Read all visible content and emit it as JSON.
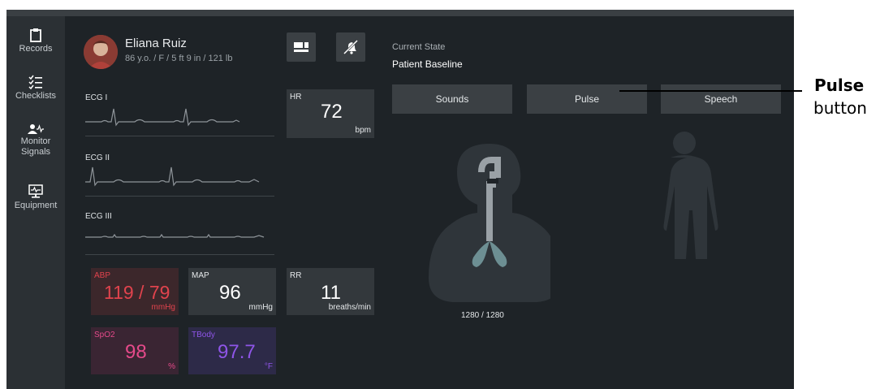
{
  "sidebar": {
    "items": [
      {
        "label": "Records",
        "icon": "clipboard-icon"
      },
      {
        "label": "Checklists",
        "icon": "checklist-icon"
      },
      {
        "label": "Monitor Signals",
        "icon": "monitor-signals-icon"
      },
      {
        "label": "Equipment",
        "icon": "equipment-icon"
      }
    ]
  },
  "patient": {
    "name": "Eliana Ruiz",
    "info": "86 y.o. / F / 5 ft 9 in / 121 lb"
  },
  "ecg": [
    {
      "label": "ECG I"
    },
    {
      "label": "ECG II"
    },
    {
      "label": "ECG III"
    }
  ],
  "vitals": {
    "hr": {
      "label": "HR",
      "value": "72",
      "unit": "bpm"
    },
    "abp": {
      "label": "ABP",
      "value": "119 / 79",
      "unit": "mmHg"
    },
    "map": {
      "label": "MAP",
      "value": "96",
      "unit": "mmHg"
    },
    "rr": {
      "label": "RR",
      "value": "11",
      "unit": "breaths/min"
    },
    "spo2": {
      "label": "SpO2",
      "value": "98",
      "unit": "%"
    },
    "tbody": {
      "label": "TBody",
      "value": "97.7",
      "unit": "°F"
    }
  },
  "state": {
    "label": "Current State",
    "value": "Patient Baseline"
  },
  "action_buttons": {
    "sounds": "Sounds",
    "pulse": "Pulse",
    "speech": "Speech"
  },
  "airway": {
    "volume": "1280 / 1280"
  },
  "callout": {
    "title": "Pulse",
    "subtitle": "button"
  },
  "colors": {
    "abp": "#e0434d",
    "spo2": "#e54a8a",
    "tbody": "#8f55e8",
    "panel_bg": "#1e2327",
    "sidebar_bg": "#2b3034"
  }
}
